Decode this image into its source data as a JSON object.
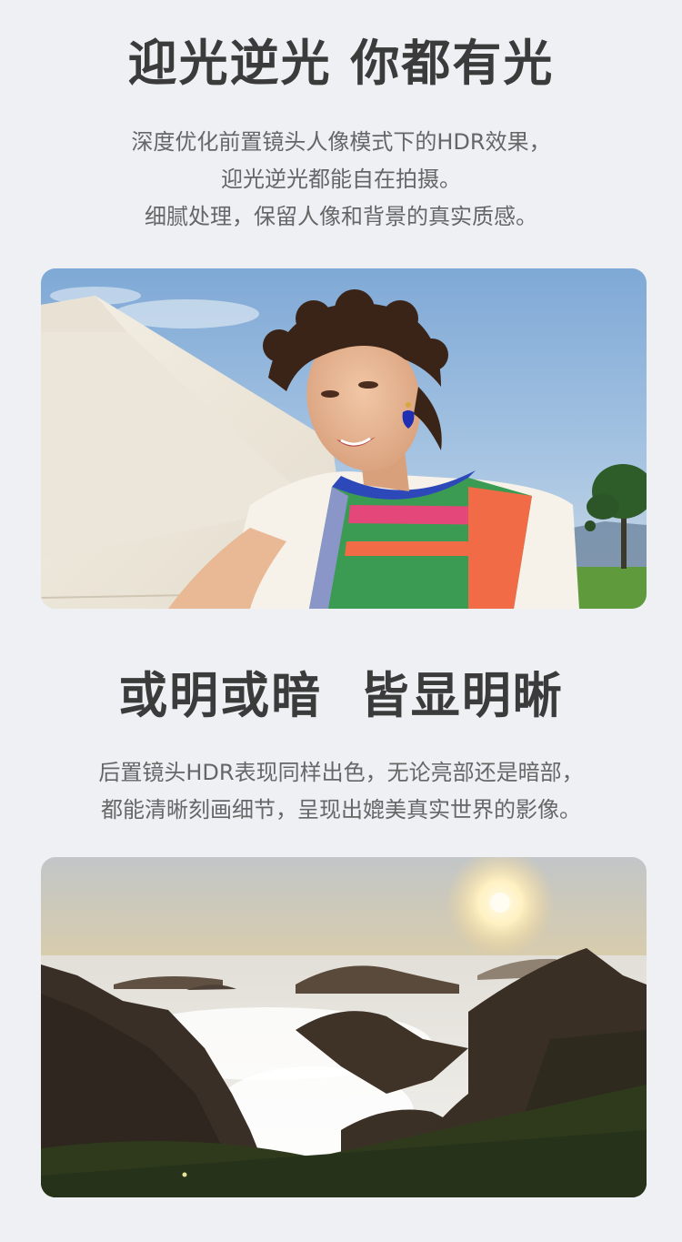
{
  "section1": {
    "title": "迎光逆光 你都有光",
    "lines": [
      "深度优化前置镜头人像模式下的HDR效果，",
      "迎光逆光都能自在拍摄。",
      "细腻处理，保留人像和背景的真实质感。"
    ]
  },
  "section2": {
    "title": "或明或暗  皆显明晰",
    "lines": [
      "后置镜头HDR表现同样出色，无论亮部还是暗部，",
      "都能清晰刻画细节，呈现出媲美真实世界的影像。"
    ]
  }
}
